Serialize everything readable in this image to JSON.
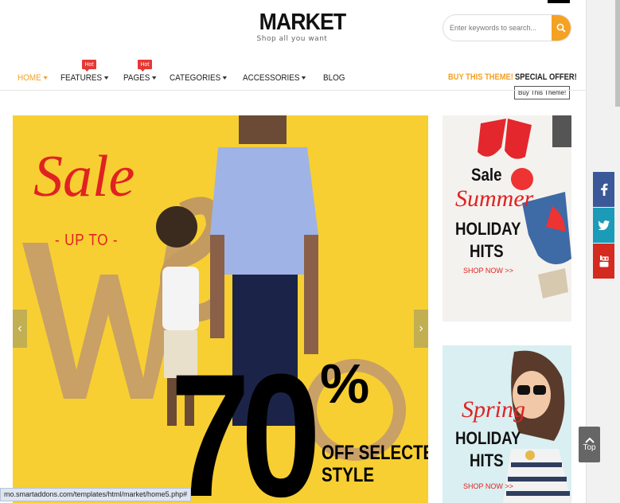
{
  "header": {
    "logo_title": "MARKET",
    "logo_subtitle": "Shop all you want",
    "search_placeholder": "Enter keywords to search..."
  },
  "nav": {
    "items": [
      {
        "label": "HOME",
        "active": true,
        "has_caret": true,
        "badge": ""
      },
      {
        "label": "FEATURES",
        "active": false,
        "has_caret": true,
        "badge": "Hot"
      },
      {
        "label": "PAGES",
        "active": false,
        "has_caret": true,
        "badge": "Hot"
      },
      {
        "label": "CATEGORIES",
        "active": false,
        "has_caret": true,
        "badge": ""
      },
      {
        "label": "ACCESSORIES",
        "active": false,
        "has_caret": true,
        "badge": ""
      },
      {
        "label": "BLOG",
        "active": false,
        "has_caret": false,
        "badge": ""
      }
    ],
    "buy_theme": "BUY THIS THEME!",
    "special_offer": "SPECIAL OFFER!",
    "tooltip": "Buy This Theme!"
  },
  "slider": {
    "sale": "Sale",
    "up_to": "- UP TO -",
    "percent_value": "70",
    "percent_sign": "%",
    "offer_line1": "OFF SELECTED",
    "offer_line2": "STYLE",
    "prev_icon": "‹",
    "next_icon": "›"
  },
  "banners": [
    {
      "sale": "Sale",
      "script": "Summer",
      "holiday": "HOLIDAY",
      "hits": "HITS",
      "cta": "SHOP NOW >>"
    },
    {
      "script": "Spring",
      "holiday": "HOLIDAY",
      "hits": "HITS",
      "cta": "SHOP NOW >>"
    }
  ],
  "top_button": "Top",
  "status_url": "mo.smartaddons.com/templates/html/market/home5.php#",
  "colors": {
    "accent": "#f4a124",
    "hot_badge": "#e53935",
    "slider_bg": "#f7cf32",
    "sale_red": "#e02222",
    "facebook": "#3b5998",
    "twitter": "#1c9bb8",
    "youtube": "#d42a1f"
  },
  "icons": [
    "search-icon",
    "facebook-icon",
    "twitter-icon",
    "youtube-icon",
    "chevron-up-icon",
    "chevron-left-icon",
    "chevron-right-icon"
  ]
}
